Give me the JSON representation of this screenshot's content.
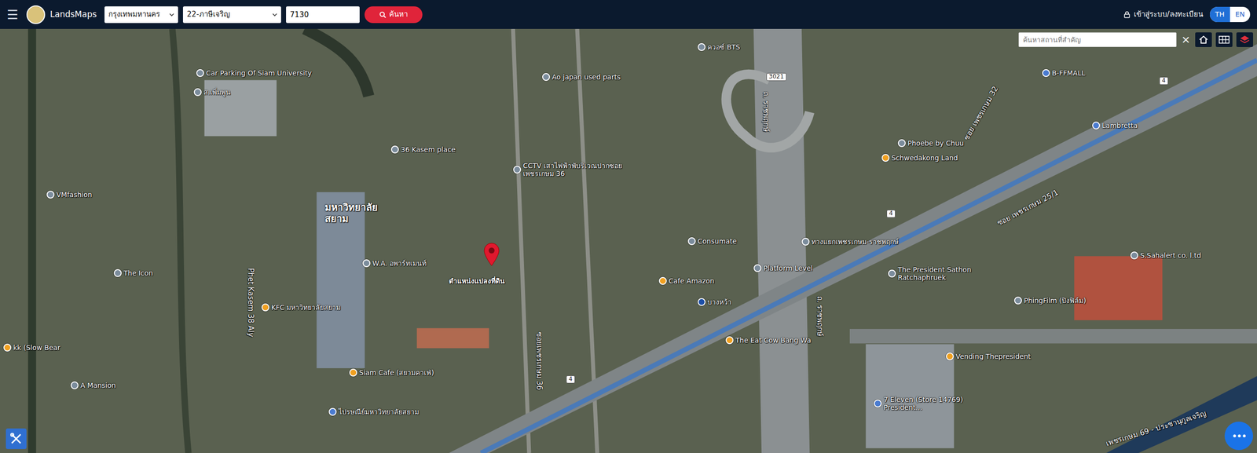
{
  "header": {
    "menu_icon": "☰",
    "logo": "LandsMaps",
    "province": "กรุงเทพมหานคร",
    "district": "22-ภาษีเจริญ",
    "parcel": "7130",
    "search_button": "ค้นหา",
    "login": "เข้าสู่ระบบ/ลงทะเบียน",
    "languages": [
      {
        "label": "TH",
        "selected": true
      },
      {
        "label": "EN",
        "selected": false
      }
    ]
  },
  "map": {
    "place_search": {
      "placeholder": "ค้นหาสถานที่สำคัญ",
      "clear": "×"
    },
    "marker": {
      "label": "ตำแหน่งแปลงที่ดิน"
    },
    "chat_button": "•••",
    "labels": [
      {
        "text": "Car Parking Of Siam University",
        "kind": "poi-gray"
      },
      {
        "text": "ส.เพิ่มพูน",
        "kind": "poi-gray"
      },
      {
        "text": "มหาวิทยาลัยสยาม",
        "kind": "area"
      },
      {
        "text": "36 Kasem place",
        "kind": "poi-gray"
      },
      {
        "text": "CCTV เสาไฟฟ้าพับริเวณปากซอยเพชรเกษม 36",
        "kind": "poi-gray"
      },
      {
        "text": "Ao japan used parts",
        "kind": "poi-gray"
      },
      {
        "text": "VMfashion",
        "kind": "poi-gray"
      },
      {
        "text": "The Icon",
        "kind": "poi-gray"
      },
      {
        "text": "Phet Kasem 38 Aly",
        "kind": "road"
      },
      {
        "text": "KFC มหาวิทยาลัยสยาม",
        "kind": "poi-orange"
      },
      {
        "text": "W.A. อพาร์ทเมนท์",
        "kind": "poi-gray"
      },
      {
        "text": "Siam Cafe (สยามคาเฟ่)",
        "kind": "poi-orange"
      },
      {
        "text": "A Mansion",
        "kind": "poi-gray"
      },
      {
        "text": "kk (Slow Bear",
        "kind": "poi-orange"
      },
      {
        "text": "Consumate",
        "kind": "poi-gray"
      },
      {
        "text": "Cafe Amazon",
        "kind": "poi-orange"
      },
      {
        "text": "Platform Level",
        "kind": "poi-gray"
      },
      {
        "text": "บางหว้า",
        "kind": "metro"
      },
      {
        "text": "The Eat Cow Bang Wa",
        "kind": "poi-orange"
      },
      {
        "text": "The President Sathon Ratchaphruek",
        "kind": "poi-gray"
      },
      {
        "text": "PhingFilm (ปิงฟิล์ม)",
        "kind": "poi-gray"
      },
      {
        "text": "Vending Thepresident",
        "kind": "poi-orange"
      },
      {
        "text": "7 Eleven (Store 14769) President...",
        "kind": "poi-blue"
      },
      {
        "text": "Phoebe by Chuu",
        "kind": "poi-gray"
      },
      {
        "text": "Schwedakong Land",
        "kind": "poi-orange"
      },
      {
        "text": "Lambretta",
        "kind": "poi-blue"
      },
      {
        "text": "S.Sahalert co. l.td",
        "kind": "poi-gray"
      },
      {
        "text": "B-FFMALL",
        "kind": "poi-blue"
      },
      {
        "text": "ซอย เพชรเกษม 25/1",
        "kind": "road"
      },
      {
        "text": "เพชรเกษม 69 - ประชานุกูลเจริญ",
        "kind": "road"
      },
      {
        "text": "ถ. ราชพฤกษ์",
        "kind": "road"
      },
      {
        "text": "ซอย เพชรเกษม 32",
        "kind": "road"
      },
      {
        "text": "ทางแยกเพชรเกษม-ราชพฤกษ์",
        "kind": "poi-gray"
      },
      {
        "text": "ซอยเพชรเกษม 36",
        "kind": "road"
      },
      {
        "text": "ไปรษณีย์มหาวิทยาลัยสยาม",
        "kind": "poi-blue"
      },
      {
        "text": "3021",
        "kind": "shield"
      },
      {
        "text": "4",
        "kind": "shield"
      },
      {
        "text": "4",
        "kind": "shield"
      },
      {
        "text": "4",
        "kind": "shield"
      },
      {
        "text": "ควอซ์ BTS",
        "kind": "poi-gray"
      },
      {
        "text": "ถ. ราชพฤกษ์",
        "kind": "road"
      }
    ]
  }
}
